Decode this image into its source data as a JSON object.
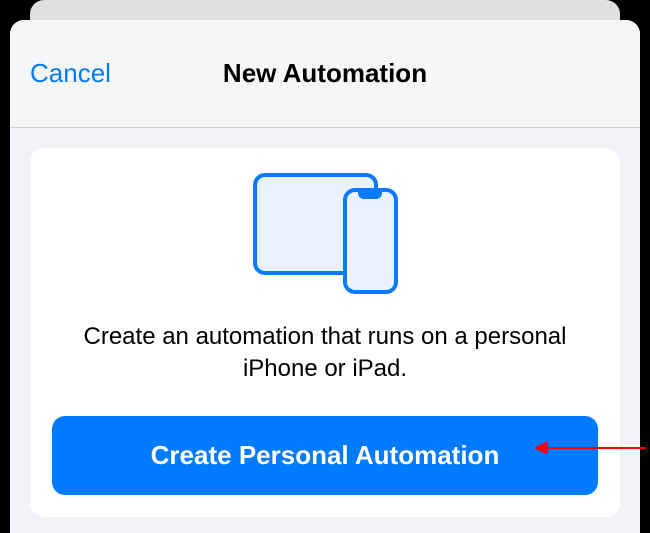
{
  "nav": {
    "cancel": "Cancel",
    "title": "New Automation"
  },
  "card": {
    "description": "Create an automation that runs on a personal iPhone or iPad.",
    "button": "Create Personal Automation"
  }
}
